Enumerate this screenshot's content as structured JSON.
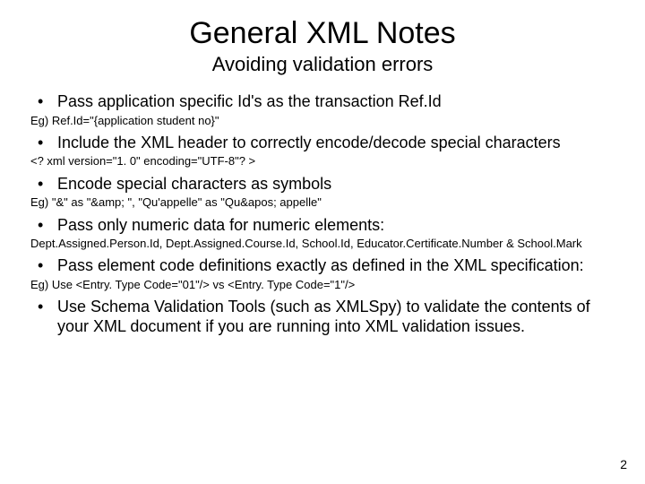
{
  "title": "General XML Notes",
  "subtitle": "Avoiding validation errors",
  "items": [
    {
      "kind": "bullet",
      "text": "Pass application specific Id's as the transaction Ref.Id"
    },
    {
      "kind": "note",
      "text": "Eg) Ref.Id=\"{application student no}\""
    },
    {
      "kind": "bullet",
      "text": "Include the XML header to correctly encode/decode special characters"
    },
    {
      "kind": "note",
      "text": "<? xml version=\"1. 0\" encoding=\"UTF-8\"? >"
    },
    {
      "kind": "bullet",
      "text": "Encode special characters as symbols"
    },
    {
      "kind": "note",
      "text": "Eg)  \"&\" as \"&amp; \", \"Qu'appelle\" as \"Qu&apos; appelle\""
    },
    {
      "kind": "bullet",
      "text": "Pass only numeric data for numeric elements:"
    },
    {
      "kind": "note",
      "text": "Dept.Assigned.Person.Id, Dept.Assigned.Course.Id, School.Id, Educator.Certificate.Number & School.Mark"
    },
    {
      "kind": "bullet",
      "text": "Pass element code definitions exactly as defined in the XML specification:"
    },
    {
      "kind": "note",
      "text": "Eg) Use <Entry. Type Code=\"01\"/> vs <Entry. Type Code=\"1\"/>"
    },
    {
      "kind": "bullet",
      "text": "Use Schema Validation Tools (such as XMLSpy) to validate the contents of your XML document if you are running into XML validation issues."
    }
  ],
  "page_number": "2"
}
